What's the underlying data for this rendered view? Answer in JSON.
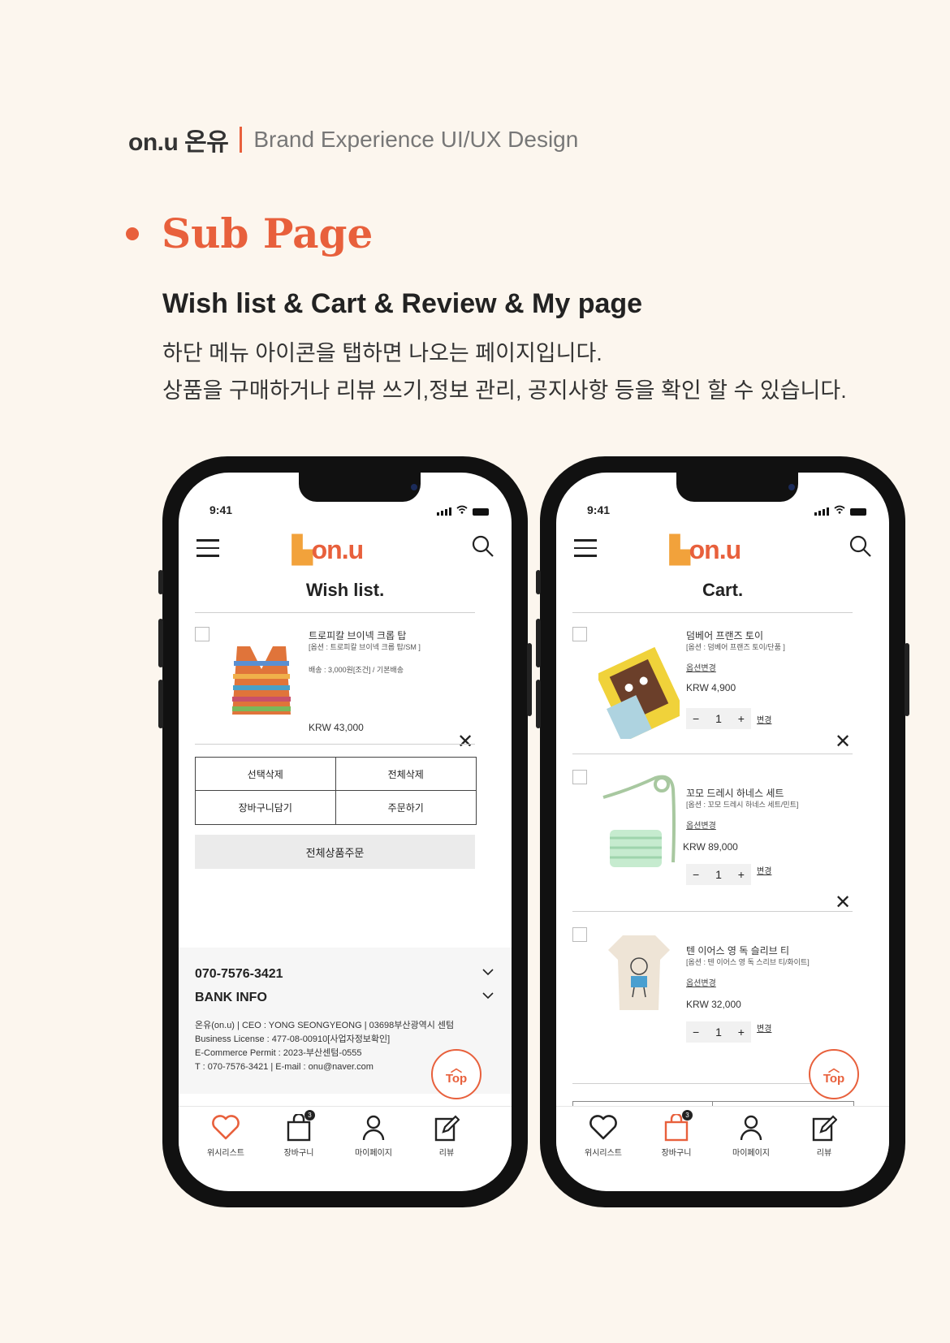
{
  "header": {
    "brand": "on.u 온유",
    "subtitle": "Brand Experience UI/UX Design"
  },
  "section": {
    "title": "Sub Page",
    "heading": "Wish list & Cart & Review & My page",
    "desc_line1": "하단 메뉴 아이콘을 탭하면 나오는 페이지입니다.",
    "desc_line2": "상품을 구매하거나 리뷰 쓰기,정보 관리, 공지사항 등을 확인 할 수 있습니다."
  },
  "colors": {
    "accent": "#e8603c",
    "background": "#fcf6ee"
  },
  "status": {
    "time": "9:41"
  },
  "logo": {
    "text": "on.u"
  },
  "wishlist": {
    "title": "Wish list.",
    "item": {
      "name": "트로피칼 브이넥 크롭 탑",
      "option": "[옵션 : 트로피칼 브이넥 크롭 탑/SM ]",
      "shipping": "배송 : 3,000원[조건] / 기본배송",
      "price": "KRW 43,000"
    },
    "buttons": {
      "select_delete": "선택삭제",
      "all_delete": "전체삭제",
      "add_cart": "장바구니담기",
      "order": "주문하기"
    },
    "order_all": "전체상품주문",
    "footer": {
      "phone": "070-7576-3421",
      "bank": "BANK INFO",
      "info1": "온유(on.u) | CEO : YONG SEONGYEONG | 03698부산광역시 센텀",
      "info2": "Business License : 477-08-00910[사업자정보확인]",
      "info3": "E-Commerce Permit : 2023-부산센텀-0555",
      "info4": "T : 070-7576-3421    |    E-mail : onu@naver.com"
    }
  },
  "cart": {
    "title": "Cart.",
    "items": [
      {
        "name": "덤베어 프랜즈 토이",
        "option": "[옵션 : 덤베어 프랜즈 토이/단품 ]",
        "change": "옵션변경",
        "price": "KRW 4,900",
        "qty": "1"
      },
      {
        "name": "꼬모 드레시 하네스 세트",
        "option": "[옵션 : 꼬모 드레시 하네스 세트/민트]",
        "change": "옵션변경",
        "price": "KRW 89,000",
        "qty": "1"
      },
      {
        "name": "텐 이어스 영 독 슬리브 티",
        "option": "[옵션 : 텐 이어스 영 독 스리브 티/화이트]",
        "change": "옵션변경",
        "price": "KRW 32,000",
        "qty": "1"
      }
    ],
    "qty_change": "변경"
  },
  "top_button": "Top",
  "tabs": {
    "wishlist": "위시리스트",
    "cart": "장바구니",
    "mypage": "마이페이지",
    "review": "리뷰",
    "cart_badge": "3"
  },
  "icons": [
    "menu-icon",
    "search-icon",
    "heart-icon",
    "bag-icon",
    "user-icon",
    "edit-icon",
    "close-icon",
    "chevron-down-icon",
    "chevron-up-icon"
  ]
}
